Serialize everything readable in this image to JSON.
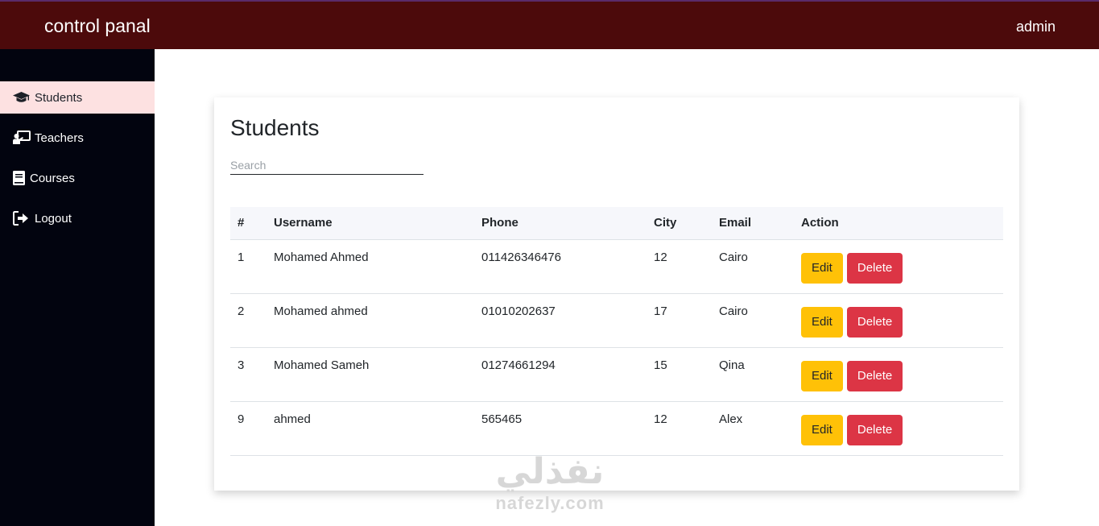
{
  "header": {
    "title": "control panal",
    "user": "admin"
  },
  "sidebar": {
    "items": [
      {
        "label": "Students",
        "icon": "graduation-cap-icon",
        "active": true
      },
      {
        "label": "Teachers",
        "icon": "chalkboard-teacher-icon",
        "active": false
      },
      {
        "label": "Courses",
        "icon": "book-icon",
        "active": false
      },
      {
        "label": "Logout",
        "icon": "sign-out-icon",
        "active": false
      }
    ]
  },
  "main": {
    "title": "Students",
    "search": {
      "placeholder": "Search",
      "value": ""
    },
    "table": {
      "columns": [
        "#",
        "Username",
        "Phone",
        "City",
        "Email",
        "Action"
      ],
      "rows": [
        {
          "id": "1",
          "username": "Mohamed Ahmed",
          "phone": "011426346476",
          "city": "12",
          "email": "Cairo"
        },
        {
          "id": "2",
          "username": "Mohamed ahmed",
          "phone": "01010202637",
          "city": "17",
          "email": "Cairo"
        },
        {
          "id": "3",
          "username": "Mohamed Sameh",
          "phone": "01274661294",
          "city": "15",
          "email": "Qina"
        },
        {
          "id": "9",
          "username": "ahmed",
          "phone": "565465",
          "city": "12",
          "email": "Alex"
        }
      ],
      "edit_label": "Edit",
      "delete_label": "Delete"
    }
  },
  "watermark": {
    "arabic": "نفذلي",
    "latin": "nafezly.com"
  },
  "colors": {
    "topbar": "#4c0a0b",
    "sidebar": "#02040f",
    "sidebar_active": "#fde1e1",
    "edit": "#ffc107",
    "delete": "#dc3545"
  }
}
